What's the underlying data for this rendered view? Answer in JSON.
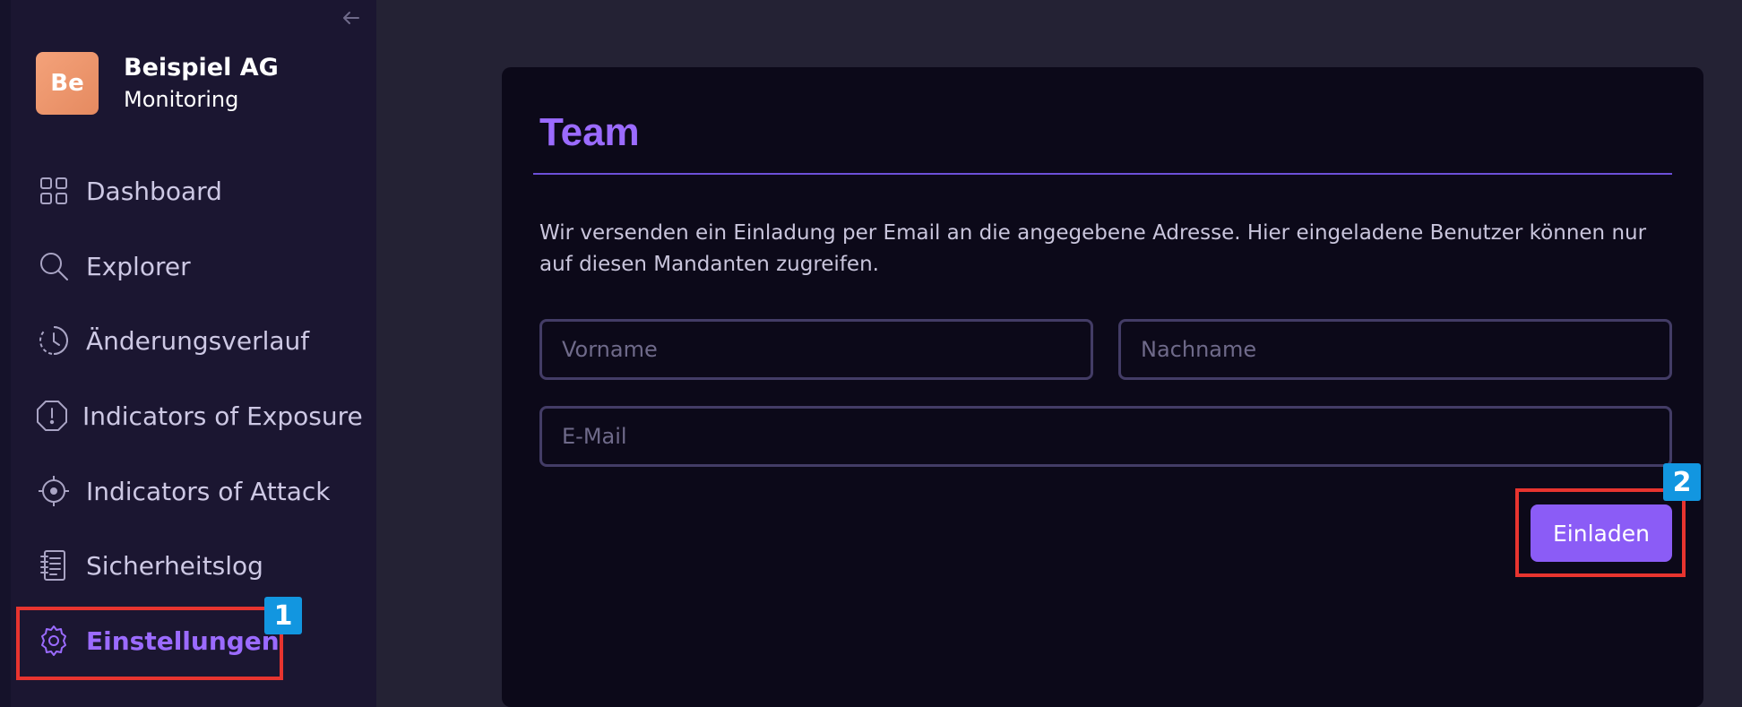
{
  "org": {
    "avatar_initials": "Be",
    "name": "Beispiel AG",
    "subtitle": "Monitoring"
  },
  "sidebar": {
    "collapse_icon": "arrow-left-icon",
    "items": [
      {
        "label": "Dashboard",
        "icon": "grid-icon",
        "active": false
      },
      {
        "label": "Explorer",
        "icon": "search-icon",
        "active": false
      },
      {
        "label": "Änderungsverlauf",
        "icon": "clock-history-icon",
        "active": false
      },
      {
        "label": "Indicators of Exposure",
        "icon": "alert-octagon-icon",
        "active": false
      },
      {
        "label": "Indicators of Attack",
        "icon": "crosshair-icon",
        "active": false
      },
      {
        "label": "Sicherheitslog",
        "icon": "log-book-icon",
        "active": false
      },
      {
        "label": "Einstellungen",
        "icon": "gear-icon",
        "active": true
      }
    ]
  },
  "main": {
    "title": "Team",
    "description": "Wir versenden ein Einladung per Email an die angegebene Adresse. Hier eingeladene Benutzer können nur auf diesen Mandanten zugreifen.",
    "form": {
      "first_name_placeholder": "Vorname",
      "last_name_placeholder": "Nachname",
      "email_placeholder": "E-Mail",
      "invite_label": "Einladen"
    }
  },
  "annotations": {
    "marker_1": "1",
    "marker_2": "2",
    "marker_color": "#e8342f",
    "tag_color": "#1296e0"
  },
  "colors": {
    "accent": "#9b6bff",
    "button": "#8b5cf6",
    "sidebar_bg": "#1b1631",
    "card_bg": "#0c0919",
    "page_bg": "#242234"
  }
}
